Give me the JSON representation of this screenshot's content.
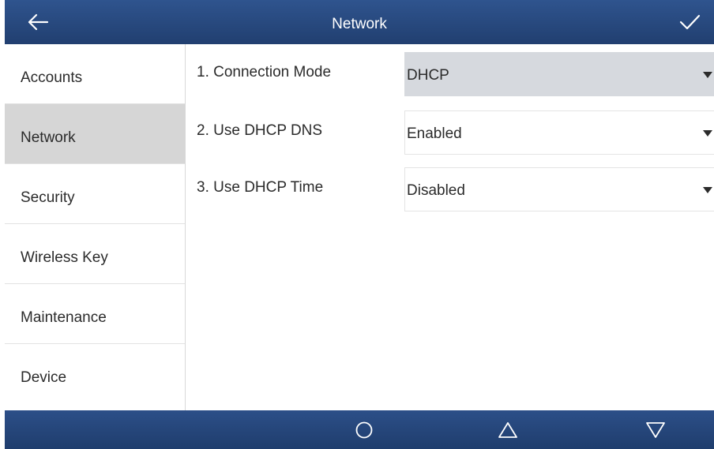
{
  "header": {
    "title": "Network",
    "back_icon": "arrow-left-icon",
    "confirm_icon": "checkmark-icon"
  },
  "sidebar": {
    "items": [
      {
        "label": "Accounts",
        "active": false
      },
      {
        "label": "Network",
        "active": true
      },
      {
        "label": "Security",
        "active": false
      },
      {
        "label": "Wireless Key",
        "active": false
      },
      {
        "label": "Maintenance",
        "active": false
      },
      {
        "label": "Device",
        "active": false
      }
    ]
  },
  "settings": {
    "rows": [
      {
        "label": "1. Connection Mode",
        "value": "DHCP",
        "focused": true
      },
      {
        "label": "2. Use DHCP DNS",
        "value": "Enabled",
        "focused": false
      },
      {
        "label": "3. Use DHCP Time",
        "value": "Disabled",
        "focused": false
      }
    ]
  },
  "navbar": {
    "icons": [
      "circle-icon",
      "triangle-up-icon",
      "triangle-down-icon"
    ]
  },
  "colors": {
    "header_blue": "#2f548e",
    "active_bg": "#d6d6d6",
    "focused_select_bg": "#d6d9de"
  }
}
